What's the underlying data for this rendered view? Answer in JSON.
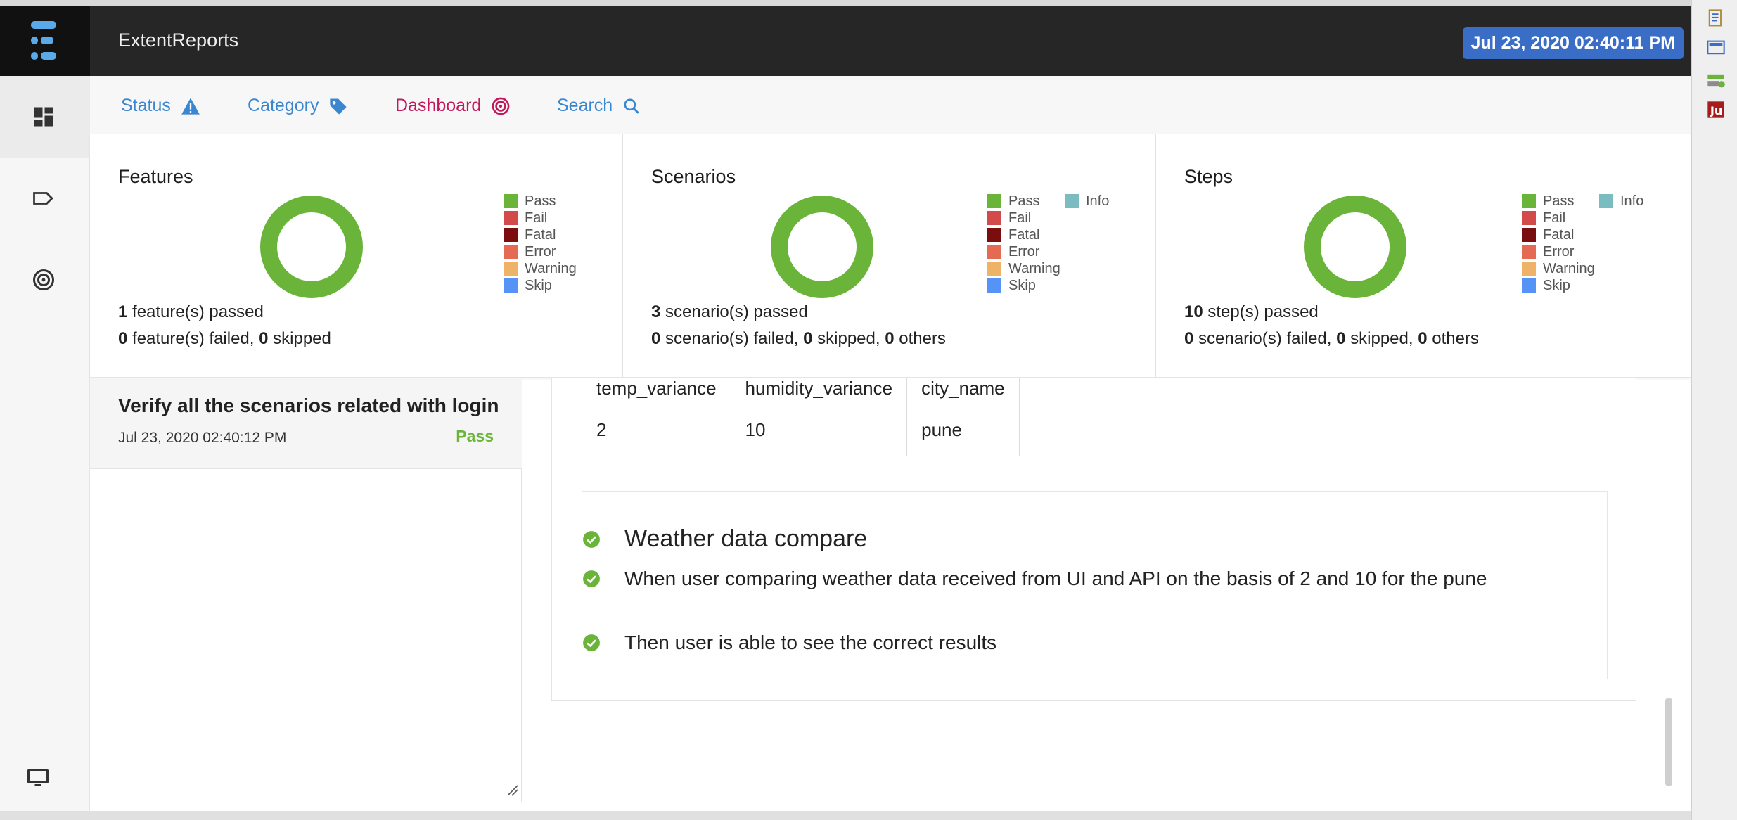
{
  "app": {
    "title": "ExtentReports",
    "timestamp": "Jul 23, 2020 02:40:11 PM"
  },
  "sidebar": {
    "items": [
      {
        "icon": "dashboard-icon",
        "active": true
      },
      {
        "icon": "tag-icon",
        "active": false
      },
      {
        "icon": "target-icon",
        "active": false
      },
      {
        "icon": "monitor-icon",
        "active": false
      }
    ]
  },
  "tabs": {
    "status": "Status",
    "category": "Category",
    "dashboard": "Dashboard",
    "search": "Search"
  },
  "colors": {
    "pass": "#6bb43a",
    "fail": "#d34a4a",
    "fatal": "#7a0d0d",
    "error": "#e46a54",
    "warning": "#eeb366",
    "skip": "#5593f7",
    "info": "#7bbcc0",
    "accent_blue": "#3a86d1",
    "accent_red": "#c2185b",
    "badge": "#3a6ec6"
  },
  "dashboard": {
    "features": {
      "title": "Features",
      "legend": [
        "Pass",
        "Fail",
        "Fatal",
        "Error",
        "Warning",
        "Skip"
      ],
      "count_passed": "1",
      "passed_text": " feature(s) passed",
      "count_failed": "0",
      "failed_text": " feature(s) failed, ",
      "count_skipped": "0",
      "skipped_text": " skipped"
    },
    "scenarios": {
      "title": "Scenarios",
      "legend": [
        "Pass",
        "Fail",
        "Fatal",
        "Error",
        "Warning",
        "Skip"
      ],
      "legend_extra": "Info",
      "count_passed": "3",
      "passed_text": " scenario(s) passed",
      "count_failed": "0",
      "failed_text": " scenario(s) failed, ",
      "count_skipped": "0",
      "skipped_text": " skipped, ",
      "count_others": "0",
      "others_text": " others"
    },
    "steps": {
      "title": "Steps",
      "legend": [
        "Pass",
        "Fail",
        "Fatal",
        "Error",
        "Warning",
        "Skip"
      ],
      "legend_extra": "Info",
      "count_passed": "10",
      "passed_text": " step(s) passed",
      "count_failed": "0",
      "failed_text": " scenario(s) failed, ",
      "count_skipped": "0",
      "skipped_text": " skipped, ",
      "count_others": "0",
      "others_text": " others"
    }
  },
  "test_list": [
    {
      "name": "Verify all the scenarios related with login",
      "time": "Jul 23, 2020 02:40:12 PM",
      "status": "Pass"
    }
  ],
  "detail": {
    "table": {
      "headers": [
        "temp_variance",
        "humidity_variance",
        "city_name"
      ],
      "rows": [
        [
          "2",
          "10",
          "pune"
        ]
      ]
    },
    "steps": [
      "Weather data compare",
      "When user comparing weather data received from UI and API on the basis of 2 and 10 for the pune",
      "Then user is able to see the correct results"
    ]
  }
}
